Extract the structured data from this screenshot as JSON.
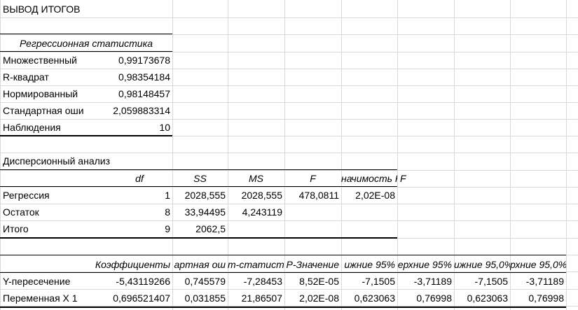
{
  "title": "ВЫВОД ИТОГОВ",
  "regression_stats": {
    "header": "Регрессионная статистика",
    "rows": [
      {
        "label": "Множественный",
        "value": "0,99173678"
      },
      {
        "label": "R-квадрат",
        "value": "0,98354184"
      },
      {
        "label": "Нормированный",
        "value": "0,98148457"
      },
      {
        "label": "Стандартная оши",
        "value": "2,059883314"
      },
      {
        "label": "Наблюдения",
        "value": "10"
      }
    ]
  },
  "anova": {
    "title": "Дисперсионный анализ",
    "headers": [
      "df",
      "SS",
      "MS",
      "F",
      "начимость F",
      "F"
    ],
    "rows": [
      {
        "label": "Регрессия",
        "df": "1",
        "ss": "2028,555",
        "ms": "2028,555",
        "f": "478,0811",
        "sig": "2,02E-08"
      },
      {
        "label": "Остаток",
        "df": "8",
        "ss": "33,94495",
        "ms": "4,243119",
        "f": "",
        "sig": ""
      },
      {
        "label": "Итого",
        "df": "9",
        "ss": "2062,5",
        "ms": "",
        "f": "",
        "sig": ""
      }
    ]
  },
  "coefficients": {
    "headers": [
      "Коэффициенты",
      "артная ош",
      "т-статисти",
      "P-Значение",
      "ижние 95%",
      "ерхние 95%",
      "ижние 95,0%",
      "рхние 95,0%"
    ],
    "rows": [
      {
        "label": "Y-пересечение",
        "values": [
          "-5,43119266",
          "0,745579",
          "-7,28453",
          "8,52E-05",
          "-7,1505",
          "-3,71189",
          "-7,1505",
          "-3,71189"
        ]
      },
      {
        "label": "Переменная X 1",
        "values": [
          "0,696521407",
          "0,031855",
          "21,86507",
          "2,02E-08",
          "0,623063",
          "0,76998",
          "0,623063",
          "0,76998"
        ]
      }
    ]
  }
}
